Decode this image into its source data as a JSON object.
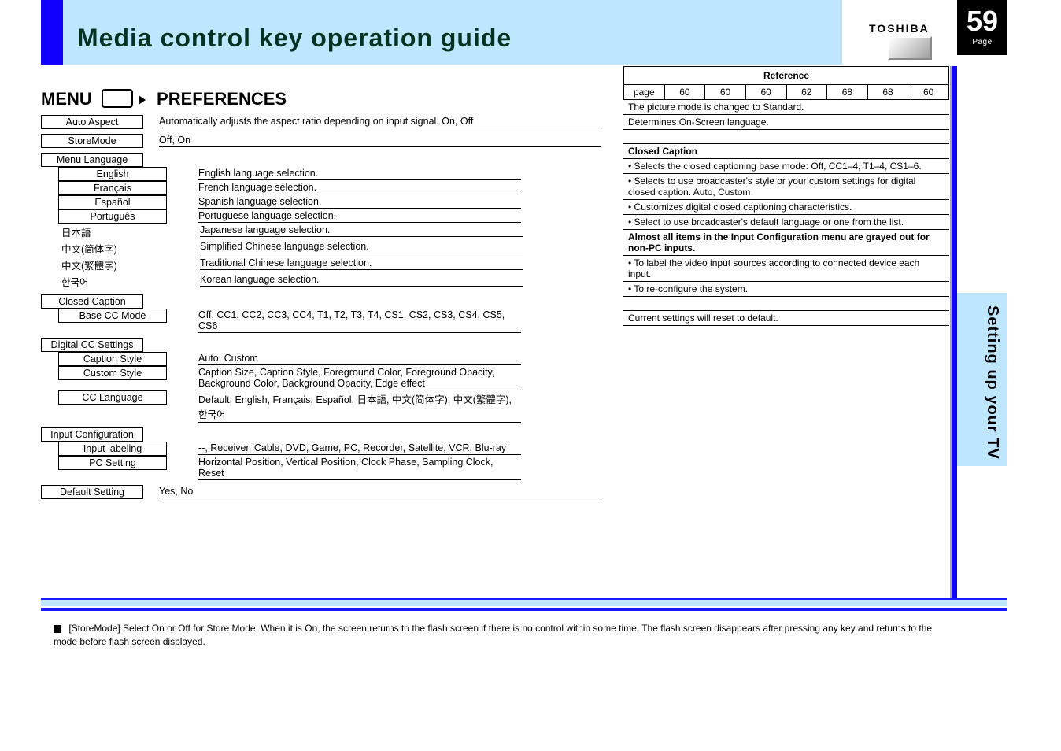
{
  "header": {
    "section_title": "Media control key operation guide",
    "brand": "TOSHIBA",
    "page_badge_num": "59",
    "page_badge_label": "Page",
    "side_tab": "Setting up your TV"
  },
  "crumb": {
    "a": "MENU",
    "b": "PREFERENCES"
  },
  "info": {
    "reference": "Reference",
    "page_cells": [
      "page",
      "60",
      "60",
      "60",
      "62",
      "68",
      "68",
      "60"
    ],
    "picture_mode_note": "The picture mode is changed to Standard.",
    "menu_lang_note": "Determines On-Screen language.",
    "cc_heading": "Closed Caption",
    "cc_a": "Selects the closed captioning base mode: Off, CC1–4, T1–4, CS1–6.",
    "cc_b": "Selects to use broadcaster's style or your custom settings for digital closed caption. Auto, Custom",
    "cc_c": "Customizes digital closed captioning characteristics.",
    "cc_d": "Select to use broadcaster's default language or one from the list.",
    "input_heading": "Almost all items in the Input Configuration menu are grayed out for non-PC inputs.",
    "input_a": "To label the video input sources according to connected device each input.",
    "input_b": "To re-configure the system.",
    "default_note": "Current settings will reset to default."
  },
  "tree": {
    "row1_l": "Auto Aspect",
    "row1_r": "Automatically adjusts the aspect ratio depending on input signal. On, Off",
    "row2_l": "StoreMode",
    "row2_r": "Off, On",
    "row3_l": "Menu Language",
    "row3_children": [
      {
        "l": "English",
        "r": "English language selection."
      },
      {
        "l": "Français",
        "r": "French language selection."
      },
      {
        "l": "Español",
        "r": "Spanish language selection."
      },
      {
        "l": "Português",
        "r": "Portuguese language selection."
      },
      {
        "l": "日本語",
        "r": "Japanese language selection."
      },
      {
        "l": "中文(简体字)",
        "r": "Simplified Chinese language selection."
      },
      {
        "l": "中文(繁體字)",
        "r": "Traditional Chinese language selection."
      },
      {
        "l": "한국어",
        "r": "Korean language selection."
      }
    ],
    "row4_l": "Closed Caption",
    "row4_children": [
      {
        "l": "Base CC Mode",
        "r": "Off, CC1, CC2, CC3, CC4, T1, T2, T3, T4, CS1, CS2, CS3, CS4, CS5, CS6"
      }
    ],
    "row5_l": "Digital CC Settings",
    "row5_children": [
      {
        "l": "Caption Style",
        "r": "Auto, Custom"
      },
      {
        "l": "Custom Style",
        "r": "Caption Size, Caption Style, Foreground Color, Foreground Opacity, Background Color, Background Opacity, Edge effect"
      },
      {
        "l": "CC Language",
        "r": "Default, English, Français, Español, 日本語, 中文(简体字), 中文(繁體字), 한국어"
      }
    ],
    "row6_l": "Input Configuration",
    "row6_children": [
      {
        "l": "Input labeling",
        "r": "--, Receiver, Cable, DVD, Game, PC, Recorder, Satellite, VCR, Blu-ray"
      },
      {
        "l": "PC Setting",
        "r": "Horizontal Position, Vertical Position, Clock Phase, Sampling Clock, Reset"
      }
    ],
    "row7_l": "Default Setting",
    "row7_r": "Yes, No"
  },
  "footnote": "[StoreMode] Select On or Off for Store Mode. When it is On, the screen returns to the flash screen if there is no control within some time. The flash screen disappears after pressing any key and returns to the mode before flash screen displayed."
}
